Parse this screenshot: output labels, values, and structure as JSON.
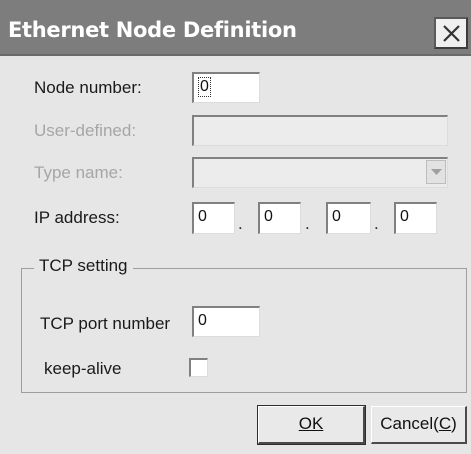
{
  "window": {
    "title": "Ethernet Node Definition",
    "close_icon": "close-icon"
  },
  "node_number": {
    "label": "Node number:",
    "value": "0"
  },
  "user_defined": {
    "label": "User-defined:",
    "value": ""
  },
  "type_name": {
    "label": "Type name:",
    "value": ""
  },
  "ip_address": {
    "label": "IP address:",
    "octets": [
      "0",
      "0",
      "0",
      "0"
    ],
    "separator": "."
  },
  "tcp_setting": {
    "legend": "TCP setting",
    "port_label": "TCP port number",
    "port_value": "0",
    "keepalive_label": "keep-alive",
    "keepalive_checked": false
  },
  "buttons": {
    "ok_label": "OK",
    "cancel_prefix": "Cancel(",
    "cancel_accel": "C",
    "cancel_suffix": ")"
  }
}
